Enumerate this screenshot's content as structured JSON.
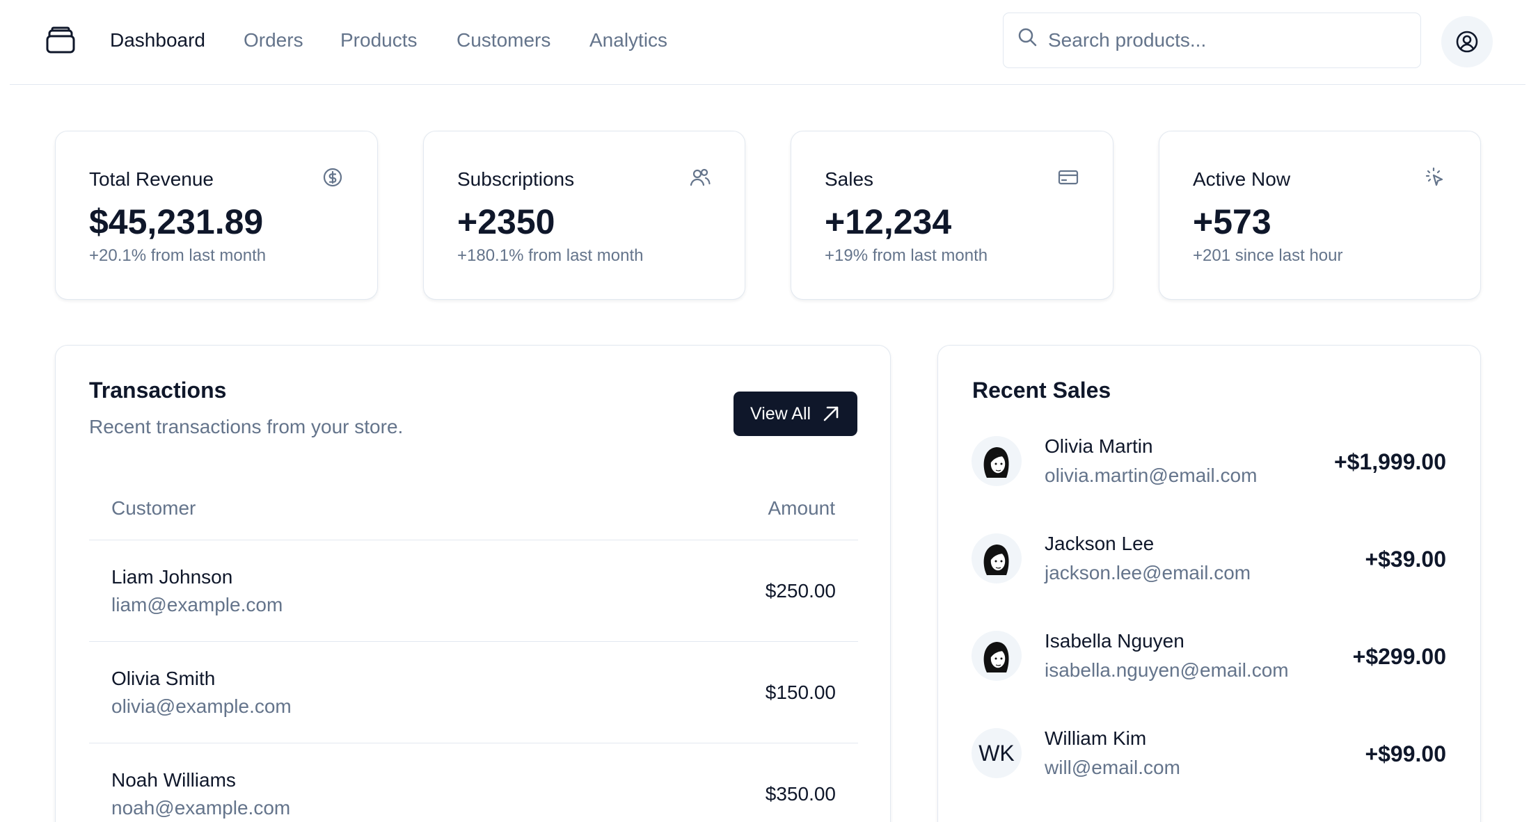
{
  "nav": {
    "items": [
      {
        "label": "Dashboard",
        "active": true
      },
      {
        "label": "Orders",
        "active": false
      },
      {
        "label": "Products",
        "active": false
      },
      {
        "label": "Customers",
        "active": false
      },
      {
        "label": "Analytics",
        "active": false
      }
    ]
  },
  "search": {
    "placeholder": "Search products...",
    "value": ""
  },
  "stats": [
    {
      "title": "Total Revenue",
      "value": "$45,231.89",
      "sub": "+20.1% from last month",
      "icon": "dollar-circle-icon"
    },
    {
      "title": "Subscriptions",
      "value": "+2350",
      "sub": "+180.1% from last month",
      "icon": "users-icon"
    },
    {
      "title": "Sales",
      "value": "+12,234",
      "sub": "+19% from last month",
      "icon": "credit-card-icon"
    },
    {
      "title": "Active Now",
      "value": "+573",
      "sub": "+201 since last hour",
      "icon": "cursor-click-icon"
    }
  ],
  "transactions": {
    "title": "Transactions",
    "description": "Recent transactions from your store.",
    "view_all_label": "View All",
    "columns": {
      "customer": "Customer",
      "amount": "Amount"
    },
    "rows": [
      {
        "name": "Liam Johnson",
        "email": "liam@example.com",
        "amount": "$250.00"
      },
      {
        "name": "Olivia Smith",
        "email": "olivia@example.com",
        "amount": "$150.00"
      },
      {
        "name": "Noah Williams",
        "email": "noah@example.com",
        "amount": "$350.00"
      }
    ]
  },
  "recent_sales": {
    "title": "Recent Sales",
    "items": [
      {
        "name": "Olivia Martin",
        "email": "olivia.martin@email.com",
        "amount": "+$1,999.00",
        "avatar": "photo"
      },
      {
        "name": "Jackson Lee",
        "email": "jackson.lee@email.com",
        "amount": "+$39.00",
        "avatar": "photo"
      },
      {
        "name": "Isabella Nguyen",
        "email": "isabella.nguyen@email.com",
        "amount": "+$299.00",
        "avatar": "photo"
      },
      {
        "name": "William Kim",
        "email": "will@email.com",
        "amount": "+$99.00",
        "avatar": "initials",
        "initials": "WK"
      }
    ]
  },
  "colors": {
    "primary": "#0f172a",
    "muted": "#64748b",
    "border": "#e2e8f0",
    "surface": "#f1f5f9"
  }
}
